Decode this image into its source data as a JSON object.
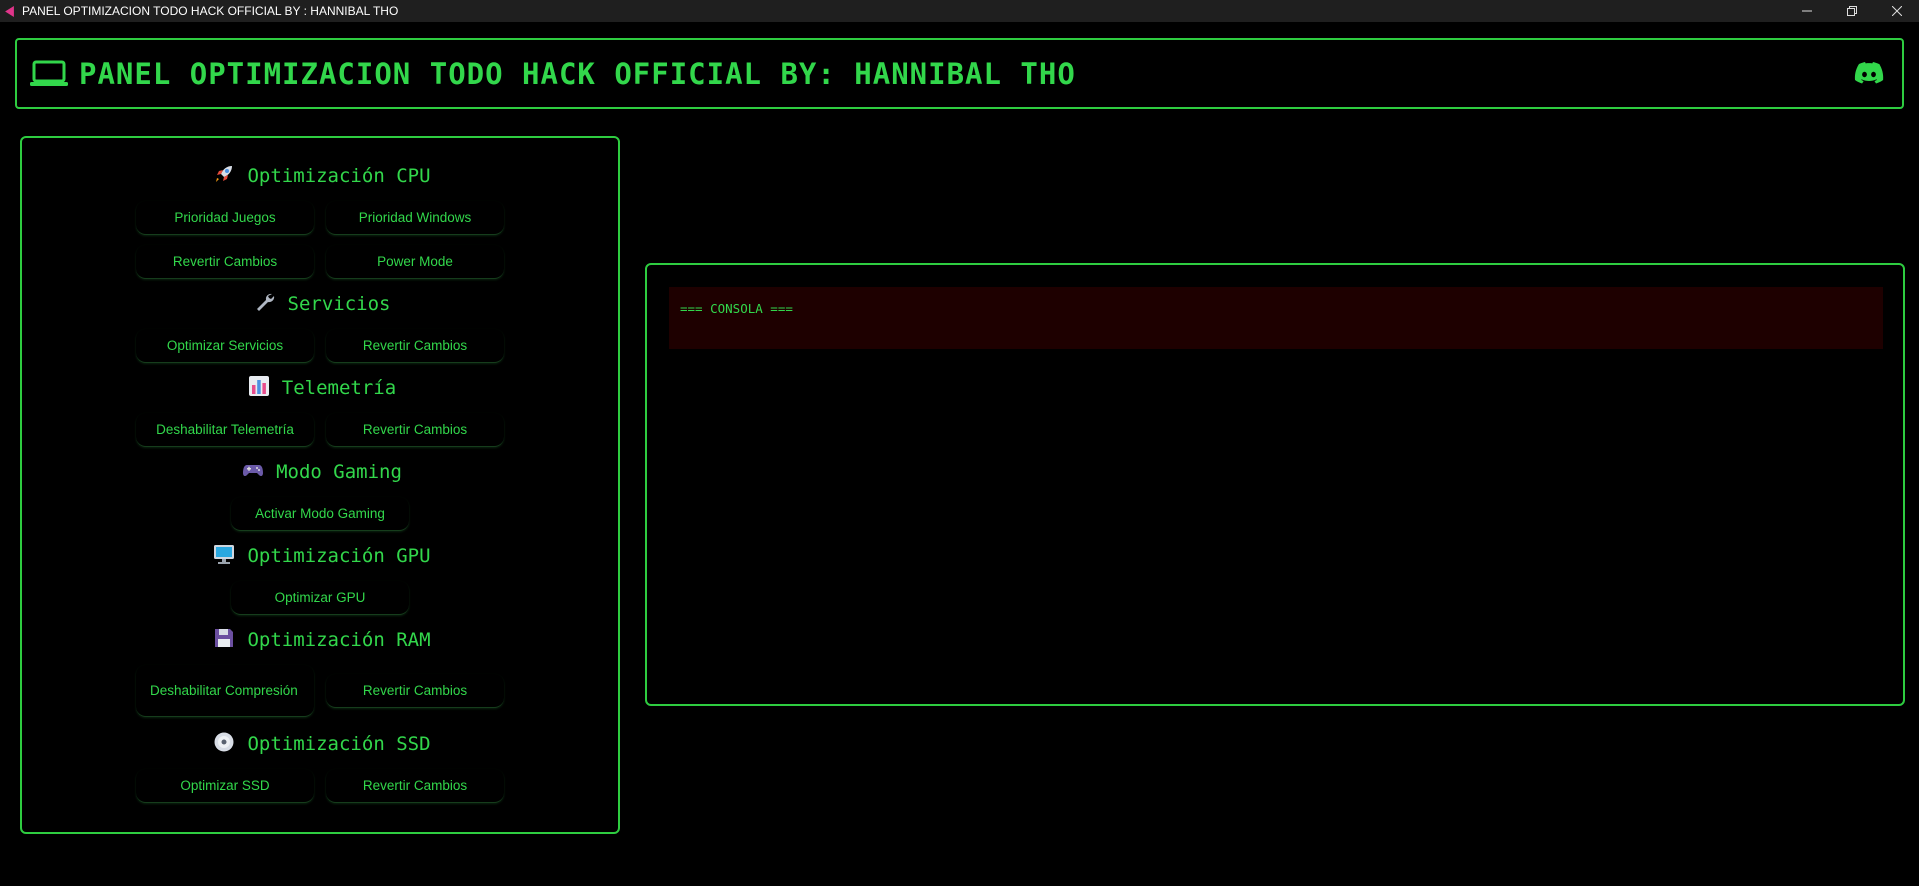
{
  "window": {
    "title": "PANEL OPTIMIZACION TODO HACK OFFICIAL BY : HANNIBAL THO",
    "controls": [
      "minimize-icon",
      "restore-icon",
      "close-icon"
    ]
  },
  "header": {
    "icon": "laptop-icon",
    "title": "PANEL OPTIMIZACION TODO HACK OFFICIAL BY: HANNIBAL THO",
    "right_icon": "discord-icon"
  },
  "colors": {
    "accent": "#32d74b",
    "border": "#2ecc40",
    "background": "#000000",
    "console_bg": "#1e0000"
  },
  "sections": [
    {
      "title": "Optimización CPU",
      "icon": "rocket-icon",
      "buttons": [
        "Prioridad Juegos",
        "Prioridad Windows",
        "Revertir Cambios",
        "Power Mode"
      ]
    },
    {
      "title": "Servicios",
      "icon": "wrench-icon",
      "buttons": [
        "Optimizar Servicios",
        "Revertir Cambios"
      ]
    },
    {
      "title": "Telemetría",
      "icon": "bar-chart-icon",
      "buttons": [
        "Deshabilitar Telemetría",
        "Revertir Cambios"
      ]
    },
    {
      "title": "Modo Gaming",
      "icon": "gamepad-icon",
      "buttons": [
        "Activar Modo Gaming"
      ]
    },
    {
      "title": "Optimización GPU",
      "icon": "monitor-icon",
      "buttons": [
        "Optimizar GPU"
      ]
    },
    {
      "title": "Optimización RAM",
      "icon": "floppy-disk-icon",
      "buttons": [
        "Deshabilitar Compresión",
        "Revertir Cambios"
      ]
    },
    {
      "title": "Optimización SSD",
      "icon": "disc-icon",
      "buttons": [
        "Optimizar SSD",
        "Revertir Cambios"
      ]
    }
  ],
  "console": {
    "text": "=== CONSOLA ==="
  }
}
